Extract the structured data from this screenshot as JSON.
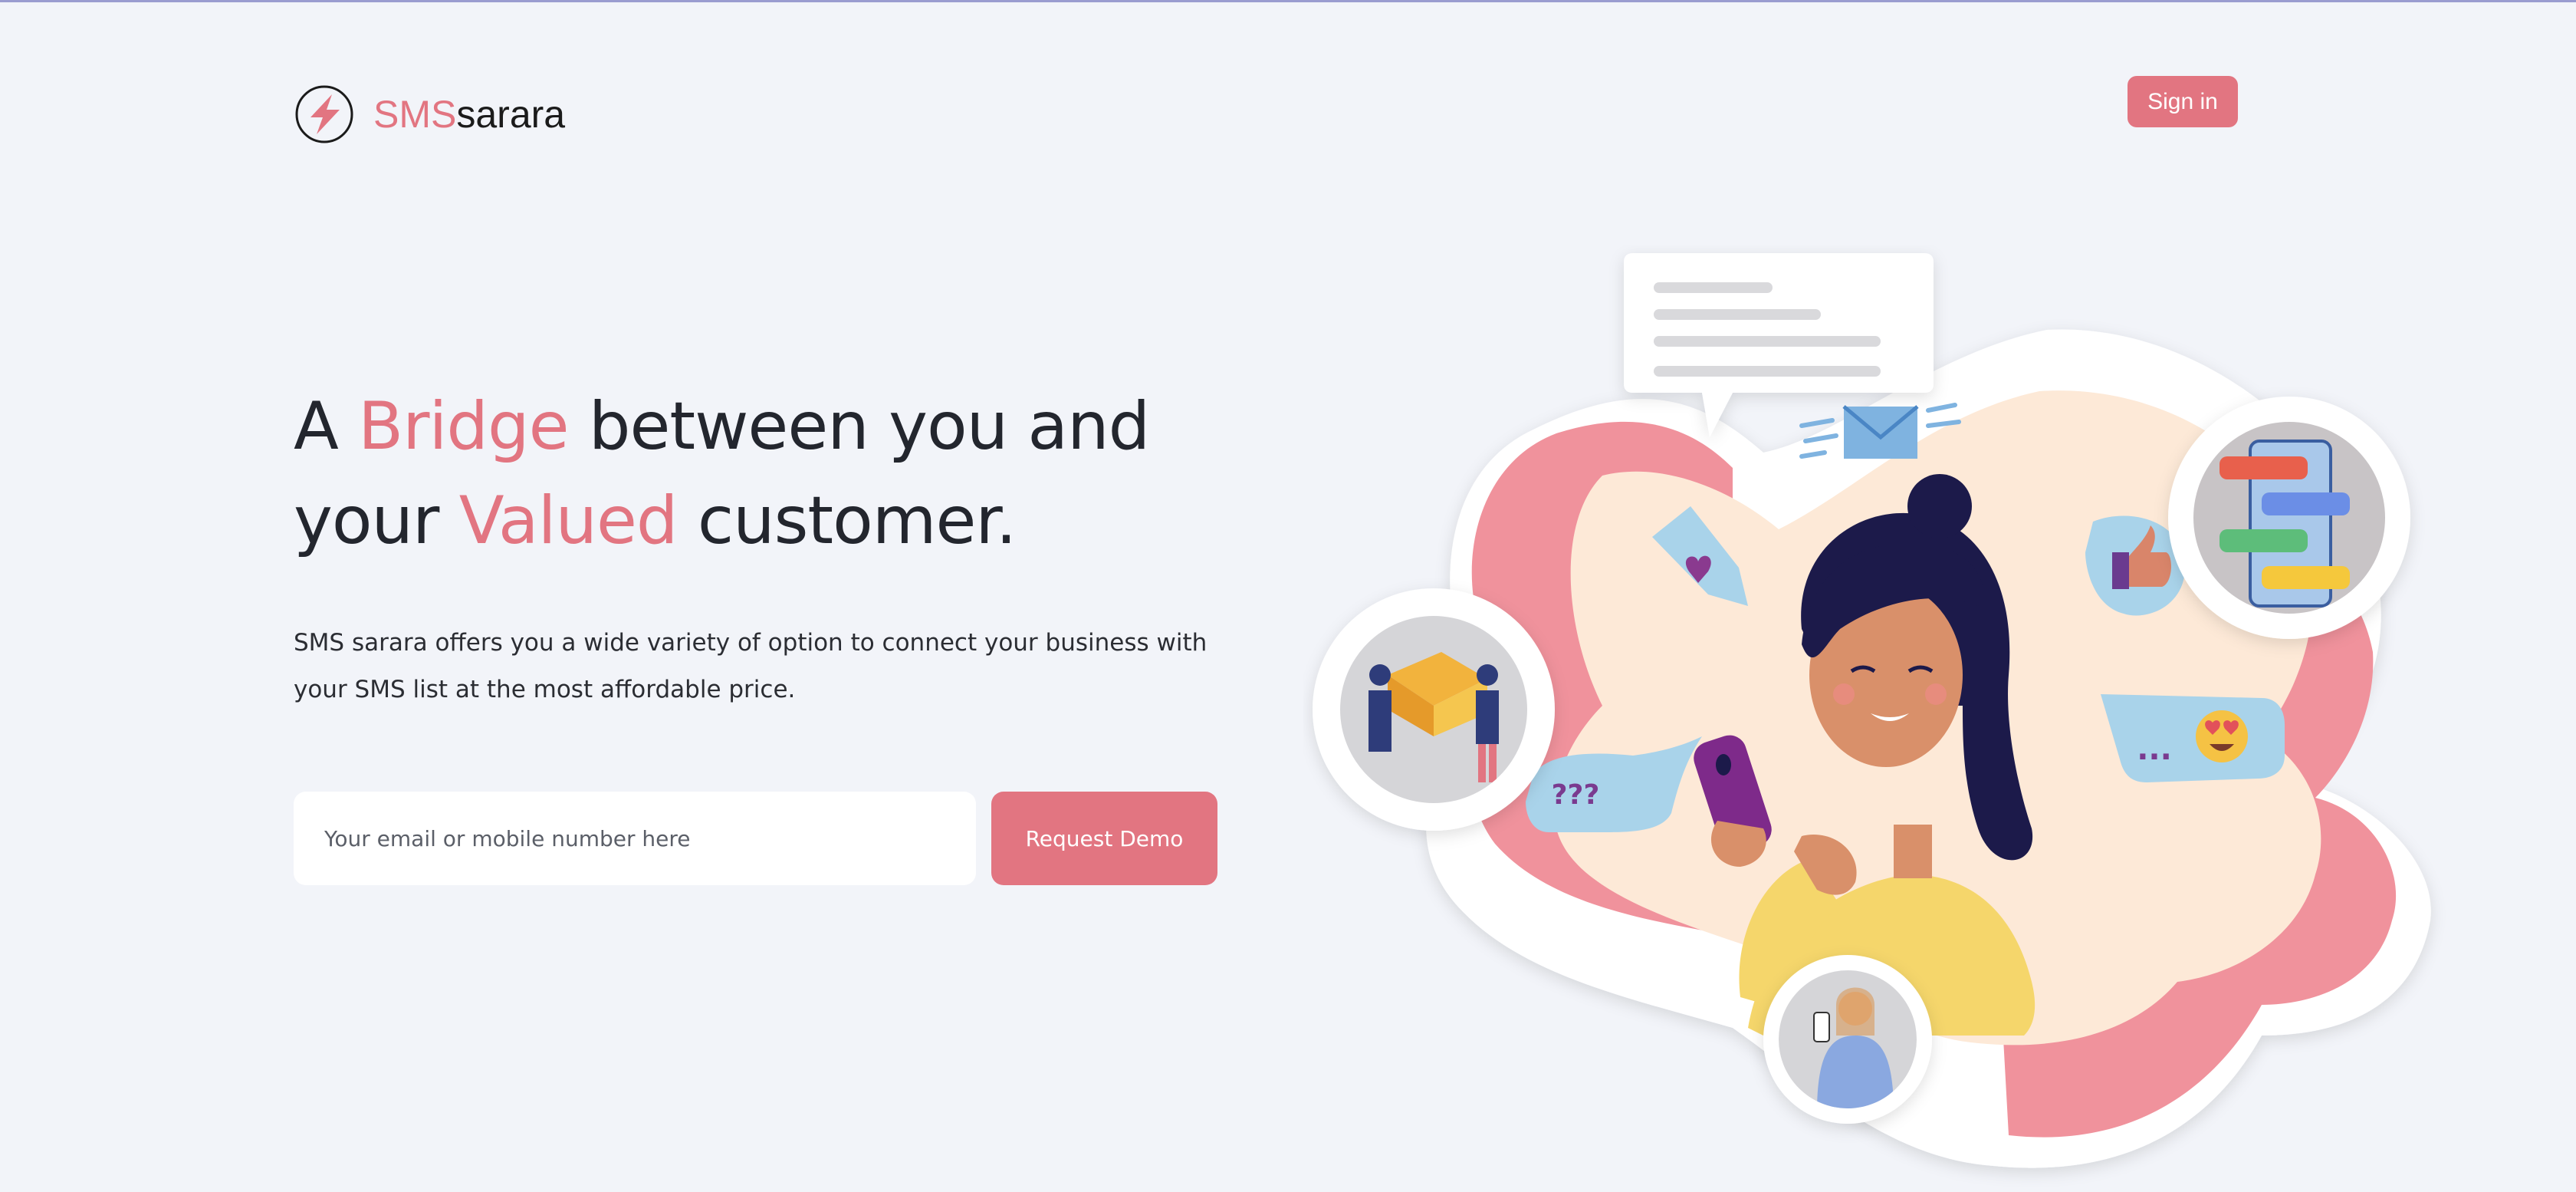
{
  "header": {
    "logo_prefix": "SMS",
    "logo_suffix": "sarara",
    "signin_label": "Sign in"
  },
  "hero": {
    "headline_1": "A ",
    "headline_accent_1": "Bridge",
    "headline_2": " between you and your ",
    "headline_accent_2": "Valued",
    "headline_3": " customer.",
    "subtext": "SMS sarara offers you a wide variety of option to connect your business with your SMS list at the most affordable price.",
    "email_placeholder": "Your email or mobile number here",
    "cta_label": "Request Demo"
  },
  "illustration": {
    "question_bubble": "???",
    "typing_bubble": "..."
  },
  "colors": {
    "accent": "#e27581",
    "background": "#f2f4f9",
    "text": "#23262e"
  },
  "icons": [
    "lightning-logo-icon",
    "envelope-icon",
    "heart-icon",
    "thumbs-up-icon",
    "heart-eyes-emoji-icon"
  ]
}
